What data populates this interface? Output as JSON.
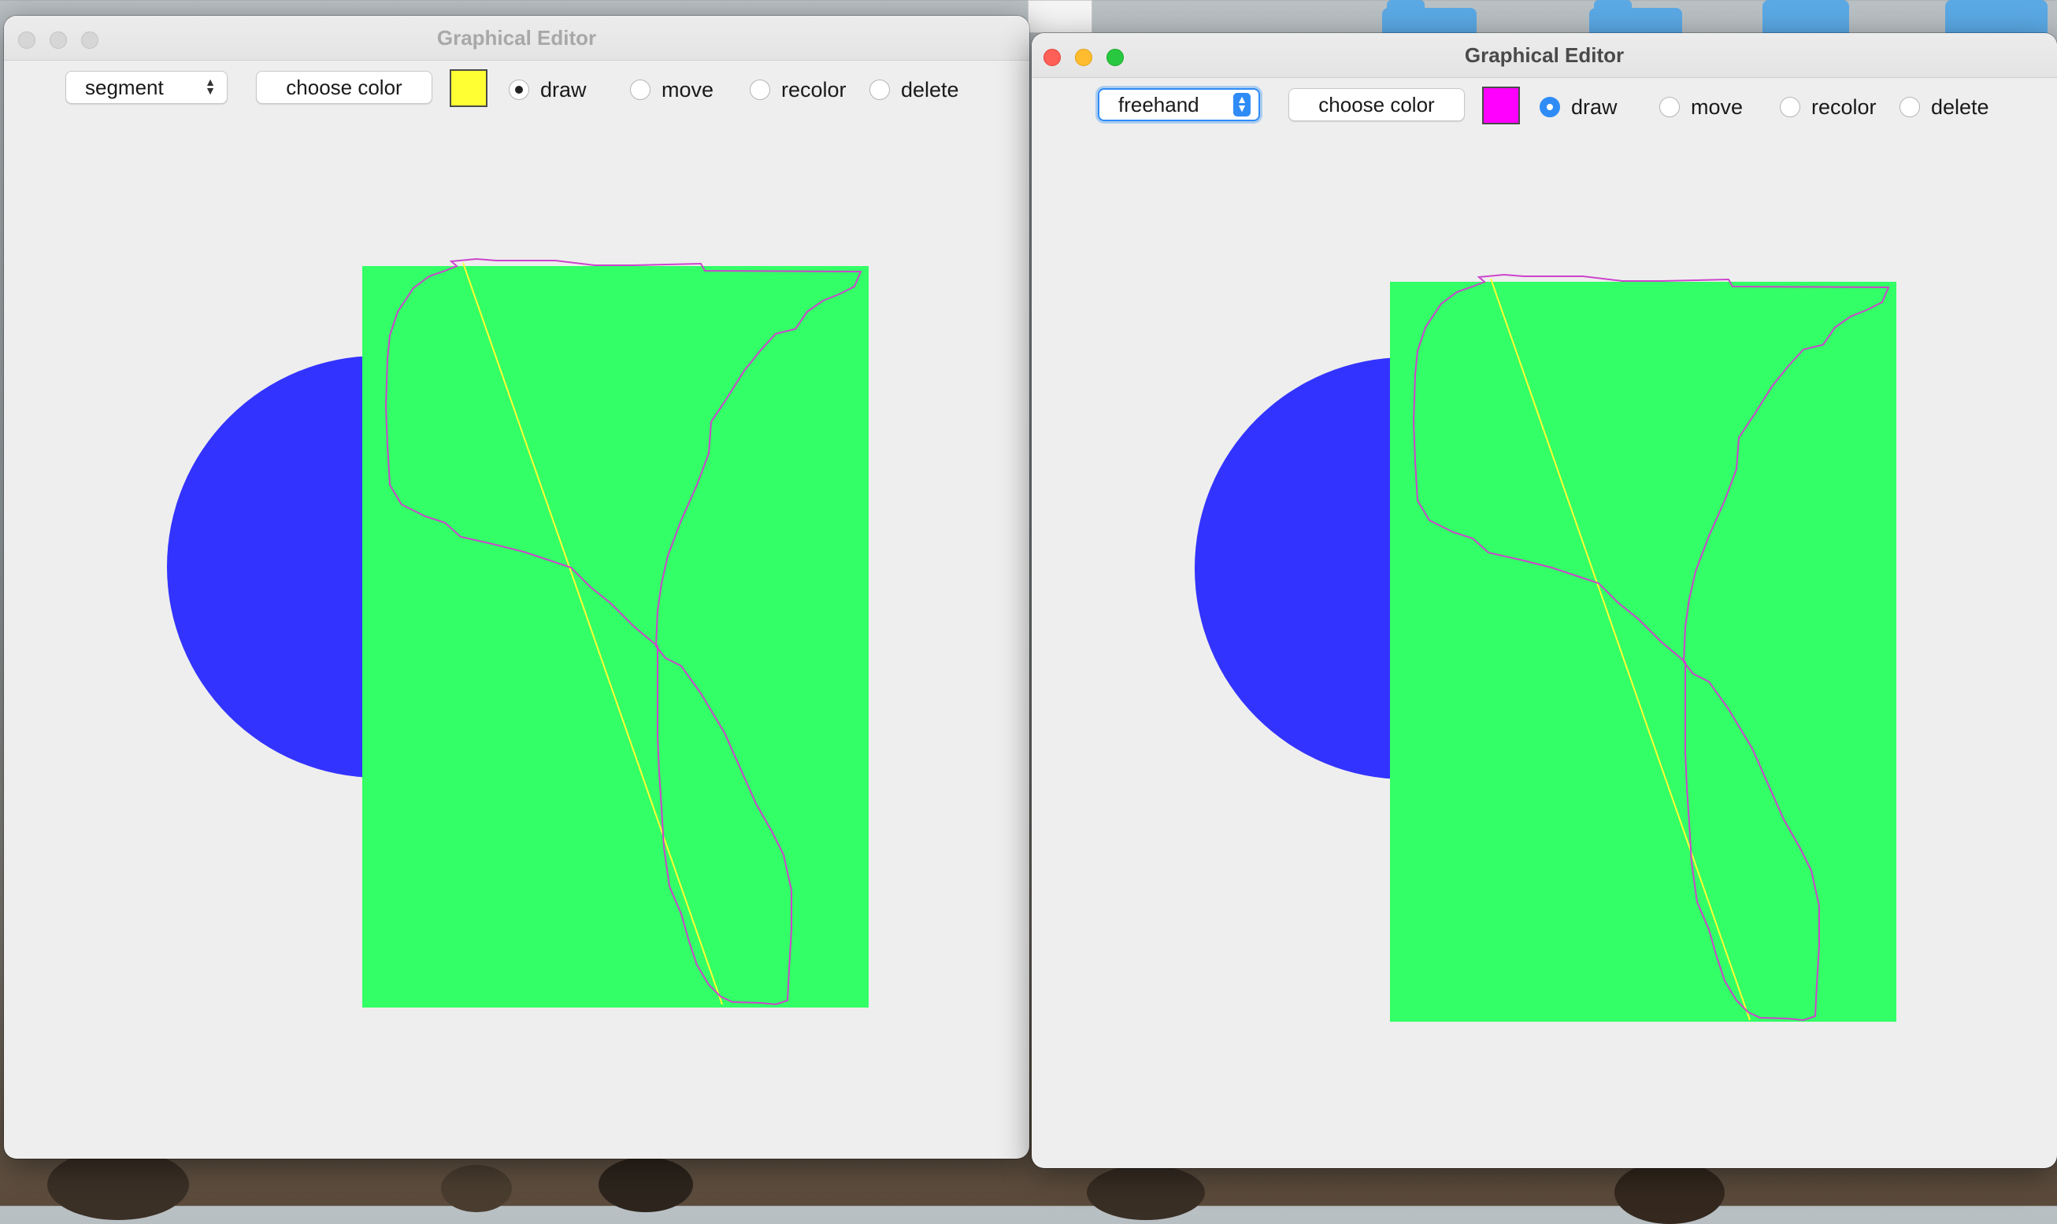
{
  "windows": [
    {
      "title": "Graphical Editor",
      "shape_select": "segment",
      "choose_color_label": "choose color",
      "current_color": "#ffff33",
      "modes": [
        "draw",
        "move",
        "recolor",
        "delete"
      ],
      "selected_mode": "draw",
      "active": false
    },
    {
      "title": "Graphical Editor",
      "shape_select": "freehand",
      "choose_color_label": "choose color",
      "current_color": "#ff00ff",
      "modes": [
        "draw",
        "move",
        "recolor",
        "delete"
      ],
      "selected_mode": "draw",
      "active": true
    }
  ],
  "shapes_colors": {
    "ellipse": "#3333ff",
    "rectangle": "#33ff66",
    "segment": "#ffff33",
    "freehand": "#cc44cc"
  },
  "icons": [
    "chevron-updown-icon"
  ]
}
